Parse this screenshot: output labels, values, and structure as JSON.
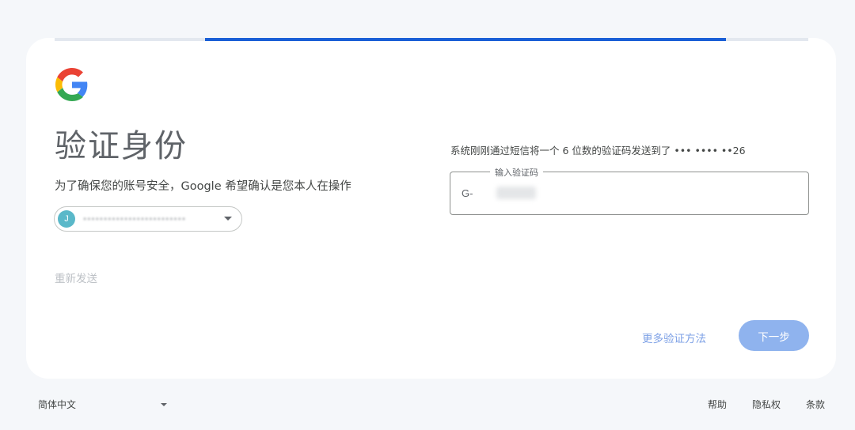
{
  "heading": "验证身份",
  "subtitle": "为了确保您的账号安全，Google 希望确认是您本人在操作",
  "account": {
    "avatar_letter": "J",
    "email_masked": "•••••••••••••••••••••••••"
  },
  "resend_label": "重新发送",
  "sms_notice": "系统刚刚通过短信将一个 6 位数的验证码发送到了 ••• •••• ••26",
  "code_field": {
    "label": "输入验证码",
    "prefix": "G-",
    "value": ""
  },
  "actions": {
    "more_methods": "更多验证方法",
    "next": "下一步"
  },
  "footer": {
    "language": "简体中文",
    "help": "帮助",
    "privacy": "隐私权",
    "terms": "条款"
  },
  "colors": {
    "accent": "#1a5fd6",
    "button": "#8fb3ee"
  }
}
